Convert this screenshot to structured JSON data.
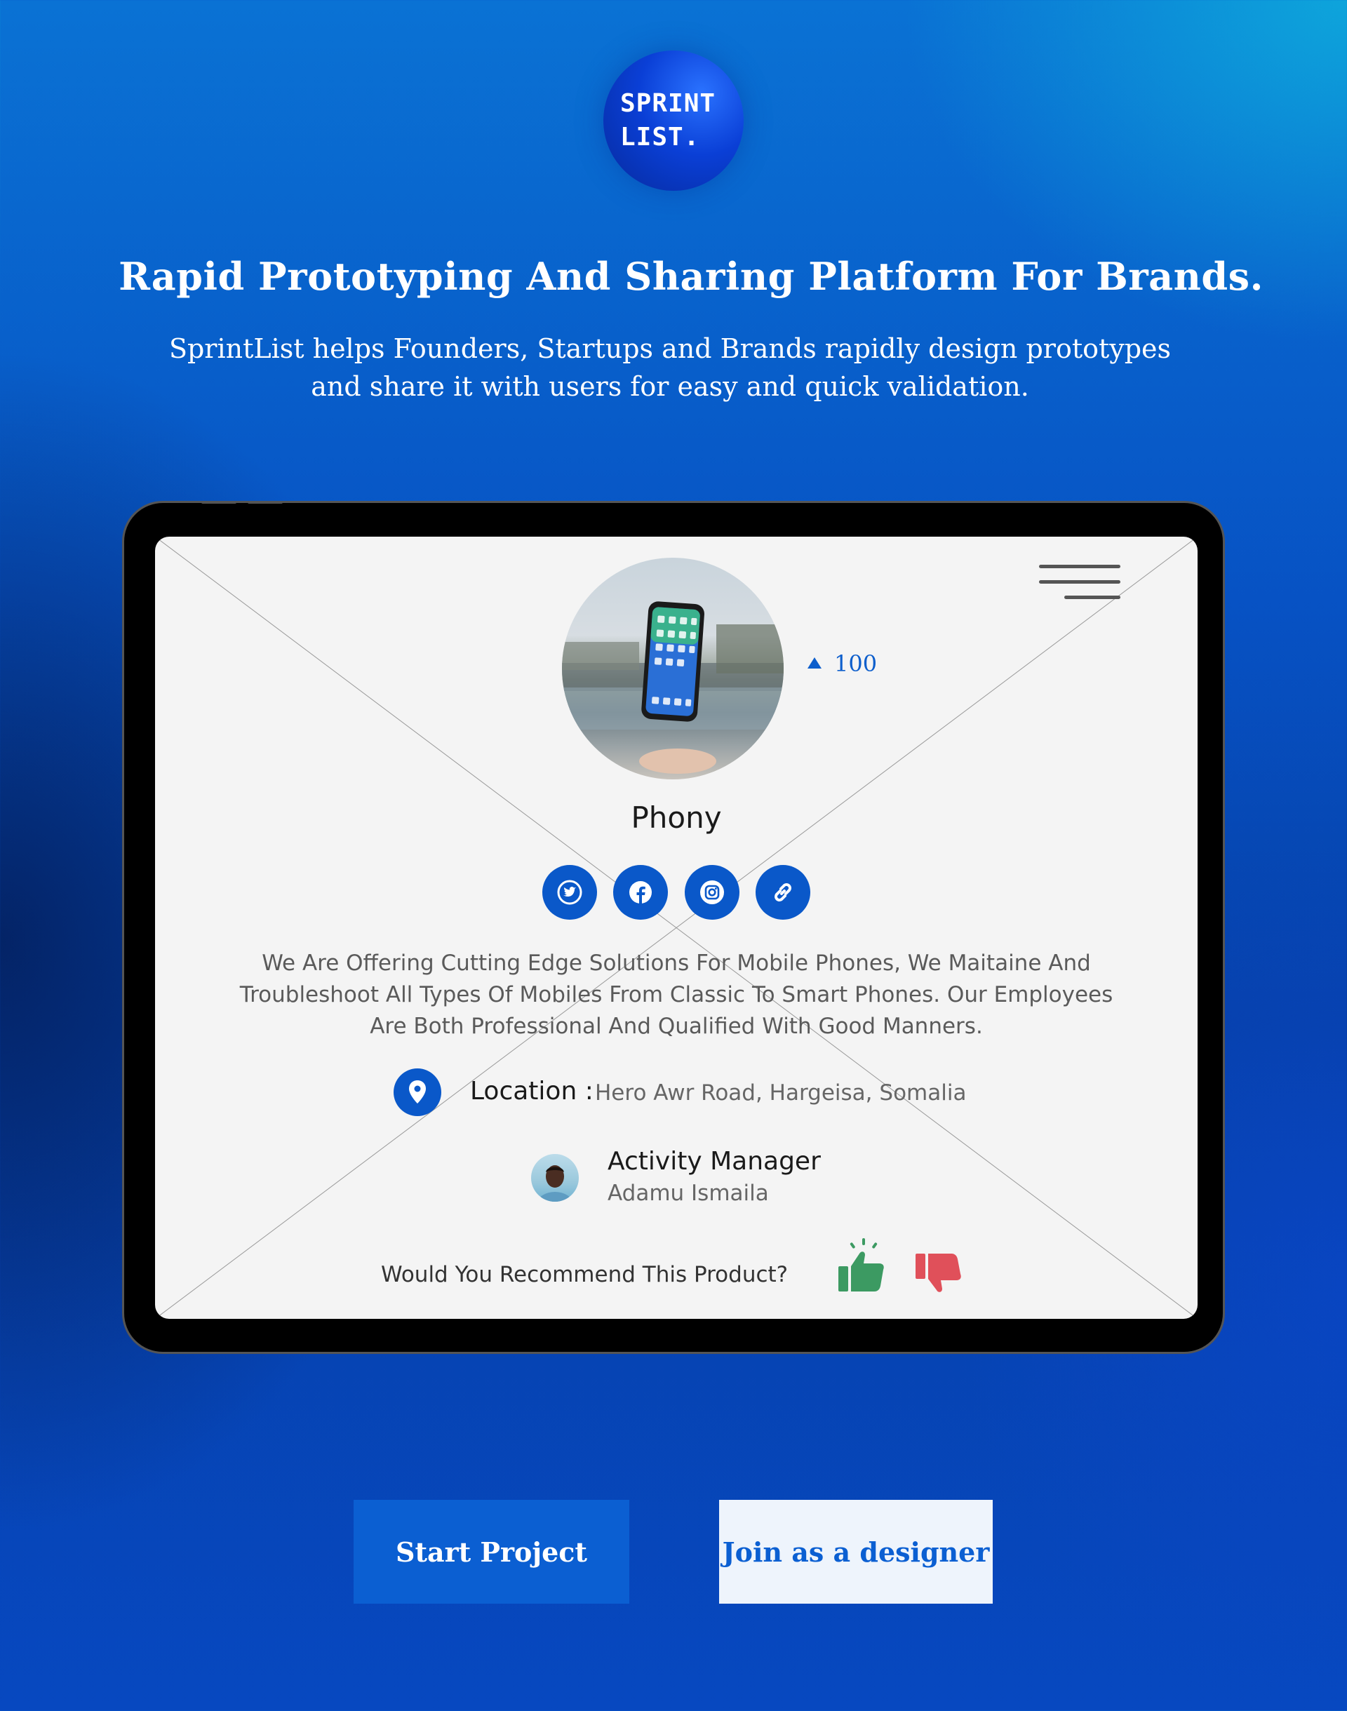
{
  "logo": {
    "line1": "SPRINT",
    "line2": "LIST."
  },
  "hero": {
    "headline": "Rapid Prototyping And Sharing Platform For Brands.",
    "subtitle_line1": "SprintList helps Founders, Startups and Brands rapidly design prototypes",
    "subtitle_line2": "and share it with users for easy and quick validation."
  },
  "profile": {
    "upvotes": "100",
    "name": "Phony",
    "socials": [
      "twitter-icon",
      "facebook-icon",
      "instagram-icon",
      "link-icon"
    ],
    "description_line1": "We Are Offering Cutting Edge Solutions For Mobile Phones, We Maitaine And",
    "description_line2": "Troubleshoot All Types Of Mobiles From Classic To Smart Phones. Our Employees",
    "description_line3": "Are Both Professional And Qualified With Good Manners.",
    "location_label": "Location :",
    "location_value": "Hero Awr Road, Hargeisa, Somalia",
    "manager_title": "Activity Manager",
    "manager_name": "Adamu Ismaila",
    "recommend_question": "Would You Recommend This Product?"
  },
  "actions": {
    "start_project": "Start Project",
    "join_designer": "Join as a designer"
  },
  "colors": {
    "accent": "#0a58c9",
    "thumb_up": "#3c9a62",
    "thumb_down": "#e0505a"
  }
}
